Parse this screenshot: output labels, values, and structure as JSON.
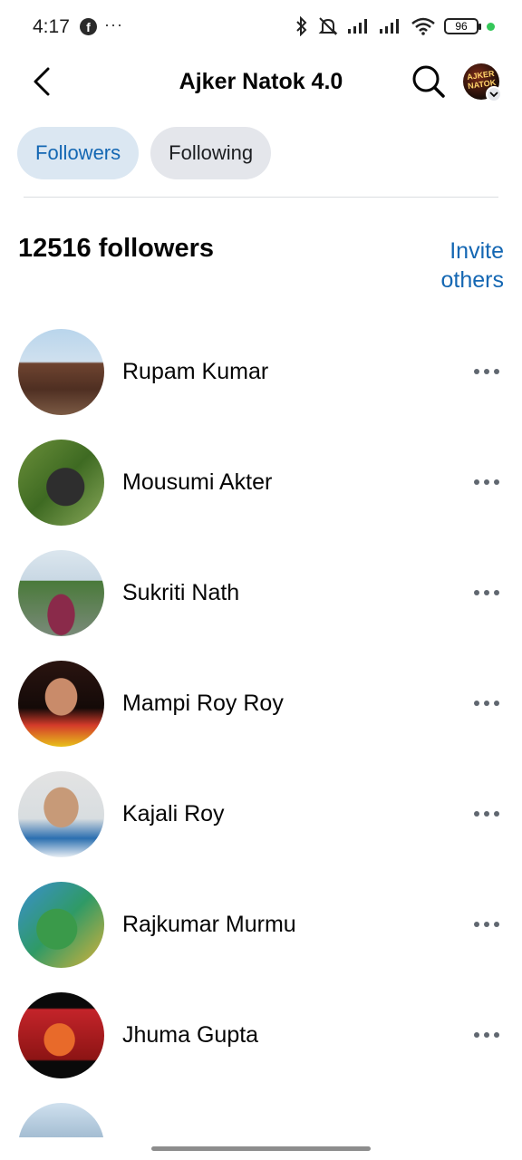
{
  "status_bar": {
    "time": "4:17",
    "battery": "96"
  },
  "header": {
    "title": "Ajker Natok 4.0",
    "profile_logo_text": "AJKER NATOK"
  },
  "tabs": [
    {
      "label": "Followers",
      "active": true
    },
    {
      "label": "Following",
      "active": false
    }
  ],
  "summary": {
    "followers_count": "12516 followers",
    "invite_label": "Invite others"
  },
  "followers": [
    {
      "name": "Rupam Kumar"
    },
    {
      "name": "Mousumi Akter"
    },
    {
      "name": "Sukriti Nath"
    },
    {
      "name": "Mampi Roy Roy"
    },
    {
      "name": "Kajali Roy"
    },
    {
      "name": "Rajkumar Murmu"
    },
    {
      "name": "Jhuma Gupta"
    },
    {
      "name": ""
    }
  ],
  "colors": {
    "accent": "#1467b3",
    "active_tab_bg": "#dbe7f2",
    "inactive_tab_bg": "#e4e6eb"
  },
  "icons": [
    "facebook-icon",
    "more-icon",
    "bluetooth-icon",
    "mute-icon",
    "signal-icon",
    "wifi-icon",
    "battery-icon",
    "back-arrow-icon",
    "search-icon",
    "chevron-down-icon",
    "more-horizontal-icon"
  ]
}
